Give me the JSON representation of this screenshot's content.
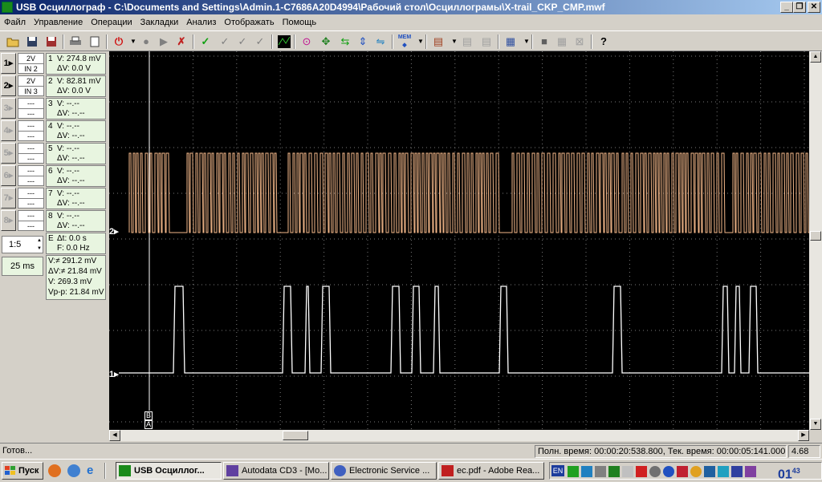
{
  "window": {
    "title": "USB Осциллограф - C:\\Documents and Settings\\Admin.1-C7686A20D4994\\Рабочий стол\\Осциллограмы\\X-trail_CKP_CMP.mwf",
    "minimize": "_",
    "restore": "❐",
    "close": "✕"
  },
  "menu": [
    "Файл",
    "Управление",
    "Операции",
    "Закладки",
    "Анализ",
    "Отображать",
    "Помощь"
  ],
  "toolbar": {
    "mem_label": "MEM",
    "help_label": "?"
  },
  "channels": [
    {
      "btn": "1▸",
      "scale": "2V",
      "input": "IN 2",
      "enabled": true,
      "num": "1",
      "v": "V: 274.8 mV",
      "dv": "ΔV: 0.0 V"
    },
    {
      "btn": "2▸",
      "scale": "2V",
      "input": "IN 3",
      "enabled": true,
      "num": "2",
      "v": "V: 82.81 mV",
      "dv": "ΔV: 0.0 V"
    },
    {
      "btn": "3▸",
      "scale": "---",
      "input": "---",
      "enabled": false,
      "num": "3",
      "v": "V: --.--",
      "dv": "ΔV: --.--"
    },
    {
      "btn": "4▸",
      "scale": "---",
      "input": "---",
      "enabled": false,
      "num": "4",
      "v": "V: --.--",
      "dv": "ΔV: --.--"
    },
    {
      "btn": "5▸",
      "scale": "---",
      "input": "---",
      "enabled": false,
      "num": "5",
      "v": "V: --.--",
      "dv": "ΔV: --.--"
    },
    {
      "btn": "6▸",
      "scale": "---",
      "input": "---",
      "enabled": false,
      "num": "6",
      "v": "V: --.--",
      "dv": "ΔV: --.--"
    },
    {
      "btn": "7▸",
      "scale": "---",
      "input": "---",
      "enabled": false,
      "num": "7",
      "v": "V: --.--",
      "dv": "ΔV: --.--"
    },
    {
      "btn": "8▸",
      "scale": "---",
      "input": "---",
      "enabled": false,
      "num": "8",
      "v": "V: --.--",
      "dv": "ΔV: --.--"
    }
  ],
  "timebase": {
    "ratio": "1:5",
    "per_div": "25 ms"
  },
  "cursor_time": {
    "label": "E",
    "dt": "Δt: 0.0 s",
    "f": "F: 0.0 Hz"
  },
  "stats": [
    "V:≠ 291.2 mV",
    "ΔV:≠ 21.84 mV",
    "V: 269.3 mV",
    "Vp-p: 21.84 mV"
  ],
  "trace_markers": {
    "ch1": "1▸",
    "ch2": "2▸",
    "cursor_b": "B",
    "cursor_a": "A"
  },
  "colors": {
    "ch1": "#ffffff",
    "ch2": "#f5b98a",
    "grid": "#7a7a7a",
    "background": "#000000"
  },
  "status": {
    "left": "Готов...",
    "times": "Полн. время: 00:00:20:538.800, Тек. время: 00:00:05:141.000",
    "value": "4.68"
  },
  "taskbar": {
    "start": "Пуск",
    "tasks": [
      {
        "label": "USB Осциллог...",
        "active": true
      },
      {
        "label": "Autodata CD3 - [Mo...",
        "active": false
      },
      {
        "label": "Electronic Service ...",
        "active": false
      },
      {
        "label": "ec.pdf - Adobe Rea...",
        "active": false
      }
    ],
    "lang": "EN",
    "clock": "01",
    "clock_min": "43"
  }
}
